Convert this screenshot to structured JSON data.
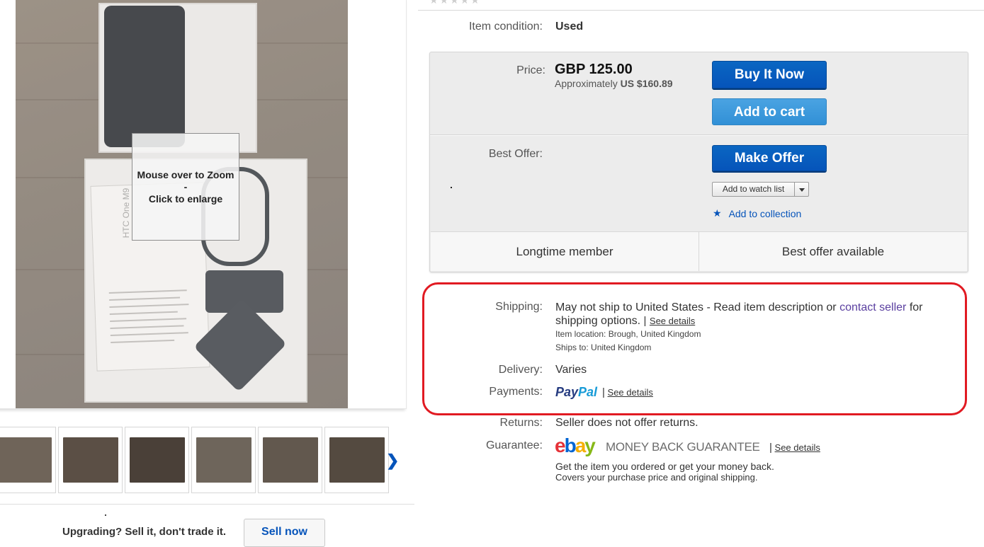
{
  "gallery": {
    "zoom_hint_line1": "Mouse over to Zoom",
    "zoom_hint_sep": "-",
    "zoom_hint_line2": "Click to enlarge",
    "leaflet_text": "HTC One M9",
    "thumbnails": [
      {
        "label": "photo 1",
        "color": "#6f6459"
      },
      {
        "label": "photo 2",
        "color": "#5b4f45"
      },
      {
        "label": "photo 3",
        "color": "#4a4038"
      },
      {
        "label": "photo 4",
        "color": "#6e655b"
      },
      {
        "label": "photo 5",
        "color": "#62584e"
      },
      {
        "label": "photo 6",
        "color": "#544a40"
      }
    ],
    "next_icon": "chevron-right-icon"
  },
  "promo": {
    "text": "Upgrading? Sell it, don't trade it.",
    "button": "Sell now"
  },
  "item": {
    "condition_label": "Item condition:",
    "condition_value": "Used"
  },
  "buybox": {
    "price_label": "Price:",
    "price": "GBP 125.00",
    "approx_prefix": "Approximately",
    "approx_value": "US $160.89",
    "buy_now": "Buy It Now",
    "add_to_cart": "Add to cart",
    "best_offer_label": "Best Offer:",
    "make_offer": "Make Offer",
    "watch_list": "Add to watch list",
    "add_collection": "Add to collection",
    "perks": [
      "Longtime member",
      "Best offer available"
    ]
  },
  "shipping": {
    "label": "Shipping:",
    "text_part1": "May not ship to United States - Read item description or",
    "contact_link": "contact seller",
    "text_part2": "for shipping options.",
    "see_details": "See details",
    "item_location": "Item location:  Brough, United Kingdom",
    "ships_to": "Ships to:  United Kingdom"
  },
  "delivery": {
    "label": "Delivery:",
    "value": "Varies"
  },
  "payments": {
    "label": "Payments:",
    "paypal_1": "Pay",
    "paypal_2": "Pal",
    "see_details": "See details"
  },
  "returns": {
    "label": "Returns:",
    "value": "Seller does not offer returns."
  },
  "guarantee": {
    "label": "Guarantee:",
    "ebay_e": "e",
    "ebay_b": "b",
    "ebay_a": "a",
    "ebay_y": "y",
    "mbg_text": "MONEY BACK GUARANTEE",
    "see_details": "See details",
    "line1": "Get the item you ordered or get your money back.",
    "line2": "Covers your purchase price and original shipping."
  },
  "colors": {
    "primary_button": "#0654ba",
    "secondary_button": "#3190d6",
    "highlight": "#e11a22",
    "link": "#0654ba",
    "visited_link": "#5a3fa0"
  }
}
